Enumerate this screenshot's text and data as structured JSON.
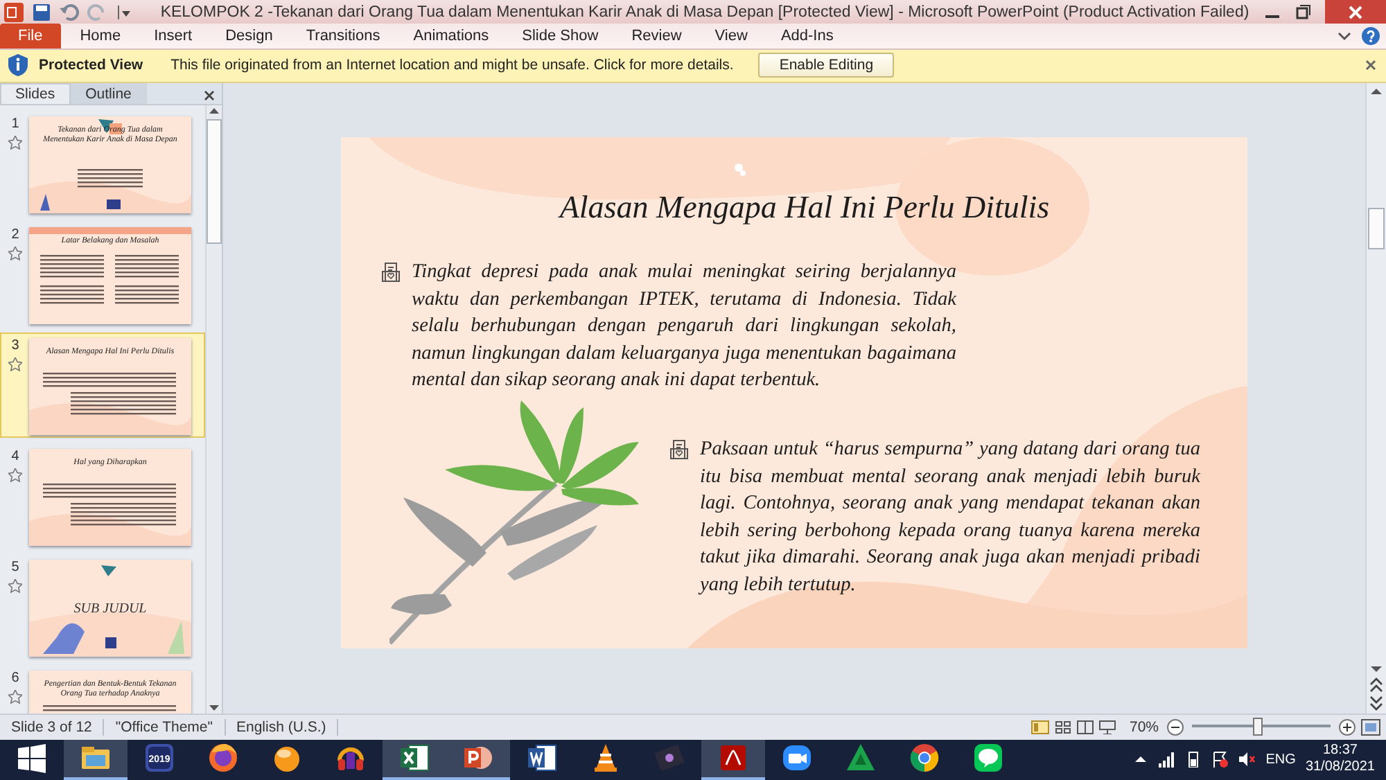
{
  "window": {
    "title": "KELOMPOK 2 -Tekanan dari Orang Tua dalam Menentukan Karir Anak di Masa Depan [Protected View]  -  Microsoft PowerPoint (Product Activation Failed)"
  },
  "ribbon_tabs": [
    {
      "label": "File",
      "kind": "file"
    },
    {
      "label": "Home",
      "kind": "tab"
    },
    {
      "label": "Insert",
      "kind": "tab"
    },
    {
      "label": "Design",
      "kind": "tab"
    },
    {
      "label": "Transitions",
      "kind": "tab"
    },
    {
      "label": "Animations",
      "kind": "tab"
    },
    {
      "label": "Slide Show",
      "kind": "tab"
    },
    {
      "label": "Review",
      "kind": "tab"
    },
    {
      "label": "View",
      "kind": "tab"
    },
    {
      "label": "Add-Ins",
      "kind": "tab"
    }
  ],
  "infobar": {
    "title": "Protected View",
    "message": "This file originated from an Internet location and might be unsafe. Click for more details.",
    "button": "Enable Editing"
  },
  "slides_panel": {
    "tabs": [
      {
        "label": "Slides",
        "selected": true
      },
      {
        "label": "Outline",
        "selected": false
      }
    ],
    "slides": [
      {
        "number": "1",
        "kind": "title",
        "title": "Tekanan dari Orang Tua dalam Menentukan Karir Anak di Masa Depan",
        "selected": false
      },
      {
        "number": "2",
        "kind": "two-column",
        "title": "Latar Belakang dan Masalah",
        "selected": false
      },
      {
        "number": "3",
        "kind": "content",
        "title": "Alasan Mengapa Hal Ini Perlu Ditulis",
        "selected": true
      },
      {
        "number": "4",
        "kind": "content",
        "title": "Hal yang Diharapkan",
        "selected": false
      },
      {
        "number": "5",
        "kind": "section",
        "title": "SUB JUDUL",
        "selected": false
      },
      {
        "number": "6",
        "kind": "content",
        "title": "Pengertian dan Bentuk-Bentuk Tekanan Orang Tua terhadap Anaknya",
        "selected": false
      }
    ]
  },
  "slide": {
    "title": "Alasan Mengapa Hal Ini Perlu Ditulis",
    "paragraphs": [
      "Tingkat depresi pada anak mulai meningkat seiring berjalannya waktu dan perkembangan IPTEK, terutama di Indonesia. Tidak selalu berhubungan dengan pengaruh dari lingkungan sekolah, namun lingkungan dalam keluarganya juga menentukan bagaimana mental dan sikap seorang anak ini dapat terbentuk.",
      "Paksaan untuk “harus sempurna” yang datang dari orang tua itu bisa membuat mental seorang anak menjadi lebih buruk lagi. Contohnya, seorang anak yang mendapat tekanan akan lebih sering berbohong kepada orang tuanya karena mereka takut jika dimarahi. Seorang anak juga akan menjadi pribadi yang lebih tertutup."
    ]
  },
  "status_bar": {
    "slide": "Slide 3 of 12",
    "theme": "\"Office Theme\"",
    "language": "English (U.S.)",
    "zoom": "70%",
    "level": 0.47
  },
  "taskbar": {
    "apps": [
      {
        "kind": "start",
        "open": false
      },
      {
        "kind": "explorer",
        "open": true
      },
      {
        "kind": "calendar",
        "label": "2019",
        "open": false
      },
      {
        "kind": "firefox",
        "open": false
      },
      {
        "kind": "ball",
        "open": false
      },
      {
        "kind": "headphones",
        "open": false
      },
      {
        "kind": "excel",
        "open": true
      },
      {
        "kind": "powerpoint",
        "open": true
      },
      {
        "kind": "word",
        "open": false
      },
      {
        "kind": "vlc",
        "open": false
      },
      {
        "kind": "film",
        "open": false
      },
      {
        "kind": "pdf",
        "open": true
      },
      {
        "kind": "zoom",
        "open": false
      },
      {
        "kind": "triangle",
        "open": false
      },
      {
        "kind": "chrome",
        "open": false
      },
      {
        "kind": "chat",
        "open": false
      }
    ],
    "tray": {
      "language": "ENG",
      "time": "18:37",
      "date": "31/08/2021"
    }
  }
}
